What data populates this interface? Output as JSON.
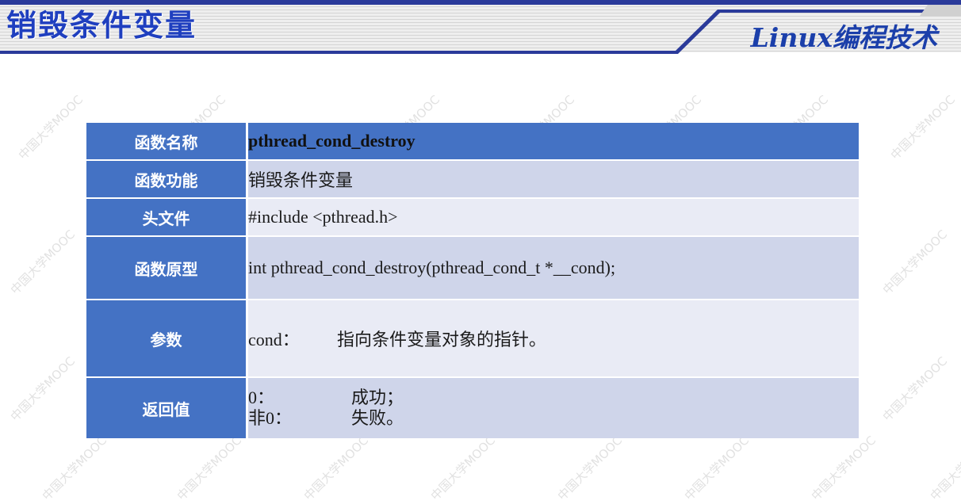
{
  "header": {
    "title": "销毁条件变量",
    "course": "Linux编程技术"
  },
  "watermark": "中国大学MOOC",
  "table": {
    "rows": [
      {
        "label": "函数名称",
        "value": "pthread_cond_destroy"
      },
      {
        "label": "函数功能",
        "value": "销毁条件变量"
      },
      {
        "label": "头文件",
        "value": "#include <pthread.h>"
      },
      {
        "label": "函数原型",
        "value": "int pthread_cond_destroy(pthread_cond_t *__cond);"
      },
      {
        "label": "参数",
        "param_name": "cond：",
        "param_desc": "指向条件变量对象的指针。"
      },
      {
        "label": "返回值",
        "lines": [
          {
            "key": "0：",
            "desc": "成功；"
          },
          {
            "key": "非0：",
            "desc": "失败。"
          }
        ]
      }
    ]
  },
  "colors": {
    "banner_blue": "#1f3fbf",
    "header_cell": "#4472c4",
    "row_dark": "#cfd5ea",
    "row_light": "#e9ebf5"
  }
}
